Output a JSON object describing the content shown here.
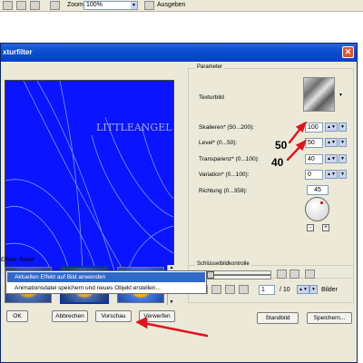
{
  "toolbar": {
    "zoom_label": "Zoom",
    "zoom_value": "100%",
    "output_label": "Ausgeben"
  },
  "dialog": {
    "title": "xturfilter",
    "close_glyph": "✕",
    "effect_label": "Effekt: Relief",
    "watermark": "LITTLEANGEL",
    "parameters": {
      "group_title": "Parameter",
      "texture_label": "Texturbild",
      "scale_label": "Skalieren* (50...200):",
      "scale_value": "100",
      "level_label": "Level* (0...50):",
      "level_value": "50",
      "transparency_label": "Transparenz* (0...100):",
      "transparency_value": "40",
      "variation_label": "Variation* (0...100):",
      "variation_value": "0",
      "direction_label": "Richtung (0...359):",
      "direction_value": "45",
      "minus_glyph": "-",
      "plus_glyph": "+"
    },
    "annotations": {
      "level_note": "50",
      "transparency_note": "40"
    },
    "keyframes": {
      "group_title": "Schlüsselbildkontrolle",
      "frame_value": "1",
      "total_frames": "/ 10",
      "frames_label": "Bilder"
    },
    "buttons": {
      "ok": "OK",
      "cancel": "Abbrechen",
      "preview": "Vorschau",
      "reset": "Verwerfen",
      "standard": "Standbild",
      "save": "Speichern..."
    },
    "popup_menu": [
      "Aktuellen Effekt auf Bild anwenden",
      "Animationsdatei speichern und neues Objekt erstellen..."
    ]
  },
  "colors": {
    "preview_bg": "#0a14ff",
    "title_bar": "#0a4fd0",
    "annotation_arrow": "#e0141e",
    "menu_highlight": "#3169c6"
  }
}
